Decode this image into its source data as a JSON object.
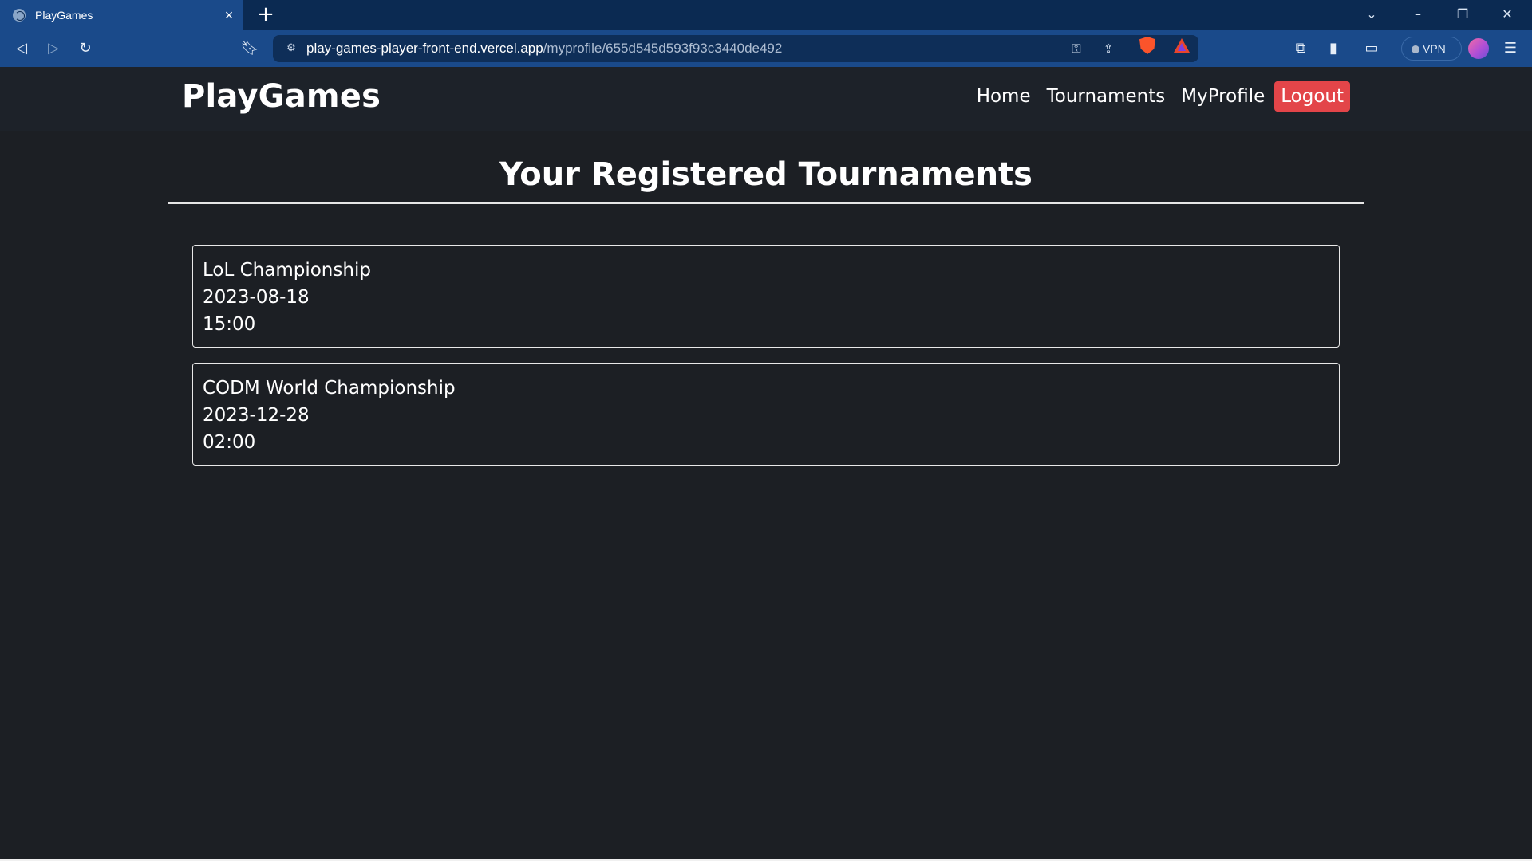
{
  "browser": {
    "tab_title": "PlayGames",
    "tab_close": "×",
    "new_tab": "+",
    "url_host": "play-games-player-front-end.vercel.app",
    "url_path": "/myprofile/655d545d593f93c3440de492",
    "vpn_label": "VPN"
  },
  "header": {
    "brand": "PlayGames",
    "nav": {
      "home": "Home",
      "tournaments": "Tournaments",
      "myprofile": "MyProfile",
      "logout": "Logout"
    }
  },
  "main": {
    "title": "Your Registered Tournaments",
    "tournaments": [
      {
        "name": "LoL Championship",
        "date": "2023-08-18",
        "time": "15:00"
      },
      {
        "name": "CODM World Championship",
        "date": "2023-12-28",
        "time": "02:00"
      }
    ]
  },
  "colors": {
    "page_bg": "#1c1f24",
    "header_bg": "#1d2229",
    "logout_bg": "#e34549",
    "browser_tab_bg": "#1a4a8a",
    "browser_frame_bg": "#0b2a52"
  }
}
